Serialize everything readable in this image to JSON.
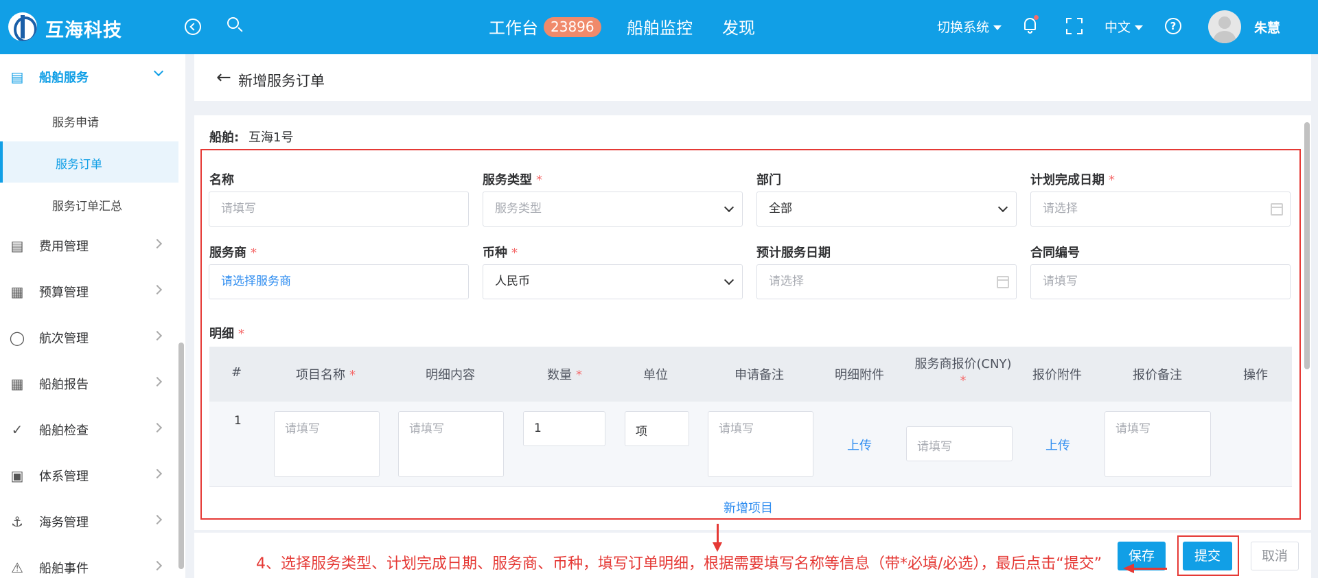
{
  "header": {
    "brand": "互海科技",
    "nav": [
      {
        "label": "工作台",
        "badge": "23896"
      },
      {
        "label": "船舶监控"
      },
      {
        "label": "发现"
      }
    ],
    "switch_system": "切换系统",
    "language": "中文",
    "user_name": "朱慧",
    "icons": [
      "back-circle-icon",
      "search-icon",
      "bell-icon",
      "fullscreen-icon",
      "help-icon"
    ]
  },
  "sidebar": {
    "groups": [
      {
        "label": "船舶服务",
        "icon": "paint-roller-icon",
        "expanded": true,
        "children": [
          {
            "label": "服务申请"
          },
          {
            "label": "服务订单",
            "active": true
          },
          {
            "label": "服务订单汇总"
          }
        ]
      },
      {
        "label": "费用管理",
        "icon": "database-icon"
      },
      {
        "label": "预算管理",
        "icon": "calculator-icon"
      },
      {
        "label": "航次管理",
        "icon": "globe-icon"
      },
      {
        "label": "船舶报告",
        "icon": "calendar-icon"
      },
      {
        "label": "船舶检查",
        "icon": "check-circle-icon"
      },
      {
        "label": "体系管理",
        "icon": "documents-icon"
      },
      {
        "label": "海务管理",
        "icon": "anchor-icon"
      },
      {
        "label": "船舶事件",
        "icon": "warning-icon"
      }
    ]
  },
  "page": {
    "title": "新增服务订单",
    "ship_label": "船舶:",
    "ship_name": "互海1号"
  },
  "form": {
    "name": {
      "label": "名称",
      "placeholder": "请填写"
    },
    "service_type": {
      "label": "服务类型",
      "required": "*",
      "placeholder": "服务类型"
    },
    "department": {
      "label": "部门",
      "value": "全部"
    },
    "planned_date": {
      "label": "计划完成日期",
      "required": "*",
      "placeholder": "请选择"
    },
    "provider": {
      "label": "服务商",
      "required": "*",
      "placeholder": "请选择服务商"
    },
    "currency": {
      "label": "币种",
      "required": "*",
      "value": "人民币"
    },
    "expected_date": {
      "label": "预计服务日期",
      "placeholder": "请选择"
    },
    "contract_no": {
      "label": "合同编号",
      "placeholder": "请填写"
    }
  },
  "details": {
    "label": "明细",
    "required": "*",
    "columns": {
      "index": "#",
      "item_name": "项目名称",
      "content": "明细内容",
      "quantity": "数量",
      "unit": "单位",
      "remark": "申请备注",
      "attachment": "明细附件",
      "quote": "服务商报价(CNY)",
      "quote_attachment": "报价附件",
      "quote_remark": "报价备注",
      "action": "操作"
    },
    "rows": [
      {
        "index": "1",
        "item_name_placeholder": "请填写",
        "content_placeholder": "请填写",
        "quantity": "1",
        "unit": "项",
        "remark_placeholder": "请填写",
        "upload": "上传",
        "quote_placeholder": "请填写",
        "quote_upload": "上传",
        "quote_remark_placeholder": "请填写"
      }
    ],
    "add_item": "新增项目"
  },
  "footer": {
    "annotation": "4、选择服务类型、计划完成日期、服务商、币种，填写订单明细，根据需要填写名称等信息（带*必填/必选），最后点击“提交”",
    "save": "保存",
    "submit": "提交",
    "cancel": "取消"
  },
  "colors": {
    "primary": "#119fe6",
    "annotation": "#e53935",
    "badge": "#f08a6b",
    "required": "#f56c6c"
  }
}
